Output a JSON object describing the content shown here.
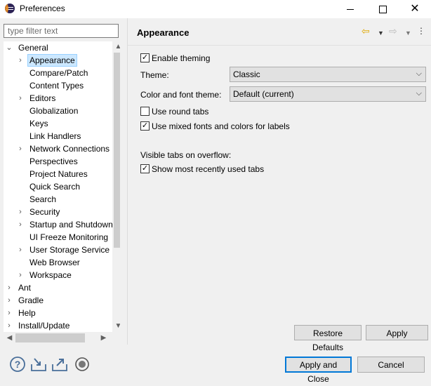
{
  "window": {
    "title": "Preferences",
    "minimize_icon": "minimize-icon",
    "maximize_icon": "maximize-icon",
    "close_icon": "close-icon"
  },
  "sidebar": {
    "filter_placeholder": "type filter text",
    "tree": [
      {
        "label": "General",
        "expanded": true,
        "level": 0
      },
      {
        "label": "Appearance",
        "expanded": false,
        "level": 1,
        "selected": true
      },
      {
        "label": "Compare/Patch",
        "level": 1
      },
      {
        "label": "Content Types",
        "level": 1
      },
      {
        "label": "Editors",
        "expanded": false,
        "level": 1
      },
      {
        "label": "Globalization",
        "level": 1
      },
      {
        "label": "Keys",
        "level": 1
      },
      {
        "label": "Link Handlers",
        "level": 1
      },
      {
        "label": "Network Connections",
        "expanded": false,
        "level": 1
      },
      {
        "label": "Perspectives",
        "level": 1
      },
      {
        "label": "Project Natures",
        "level": 1
      },
      {
        "label": "Quick Search",
        "level": 1
      },
      {
        "label": "Search",
        "level": 1
      },
      {
        "label": "Security",
        "expanded": false,
        "level": 1
      },
      {
        "label": "Startup and Shutdown",
        "expanded": false,
        "level": 1
      },
      {
        "label": "UI Freeze Monitoring",
        "level": 1
      },
      {
        "label": "User Storage Service",
        "expanded": false,
        "level": 1
      },
      {
        "label": "Web Browser",
        "level": 1
      },
      {
        "label": "Workspace",
        "expanded": false,
        "level": 1
      },
      {
        "label": "Ant",
        "expanded": false,
        "level": 0
      },
      {
        "label": "Gradle",
        "expanded": false,
        "level": 0
      },
      {
        "label": "Help",
        "expanded": false,
        "level": 0
      },
      {
        "label": "Install/Update",
        "expanded": false,
        "level": 0
      }
    ]
  },
  "page": {
    "title": "Appearance",
    "back_icon": "back-arrow-icon",
    "forward_icon": "forward-arrow-icon",
    "menu_icon": "view-menu-icon",
    "enable_theming": {
      "label": "Enable theming",
      "checked": true
    },
    "theme": {
      "label": "Theme:",
      "value": "Classic"
    },
    "color_font_theme": {
      "label": "Color and font theme:",
      "value": "Default (current)"
    },
    "round_tabs": {
      "label": "Use round tabs",
      "checked": false
    },
    "mixed_fonts": {
      "label": "Use mixed fonts and colors for labels",
      "checked": true
    },
    "overflow_heading": "Visible tabs on overflow:",
    "recent_tabs": {
      "label": "Show most recently used tabs",
      "checked": true
    },
    "restore_defaults": "Restore Defaults",
    "apply": "Apply"
  },
  "footer": {
    "apply_close": "Apply and Close",
    "cancel": "Cancel",
    "icons": [
      "help-icon",
      "import-icon",
      "export-icon",
      "record-icon"
    ]
  },
  "colors": {
    "selection_bg": "#cce8ff",
    "default_button_border": "#0078d7",
    "back_arrow": "#e0a800"
  }
}
